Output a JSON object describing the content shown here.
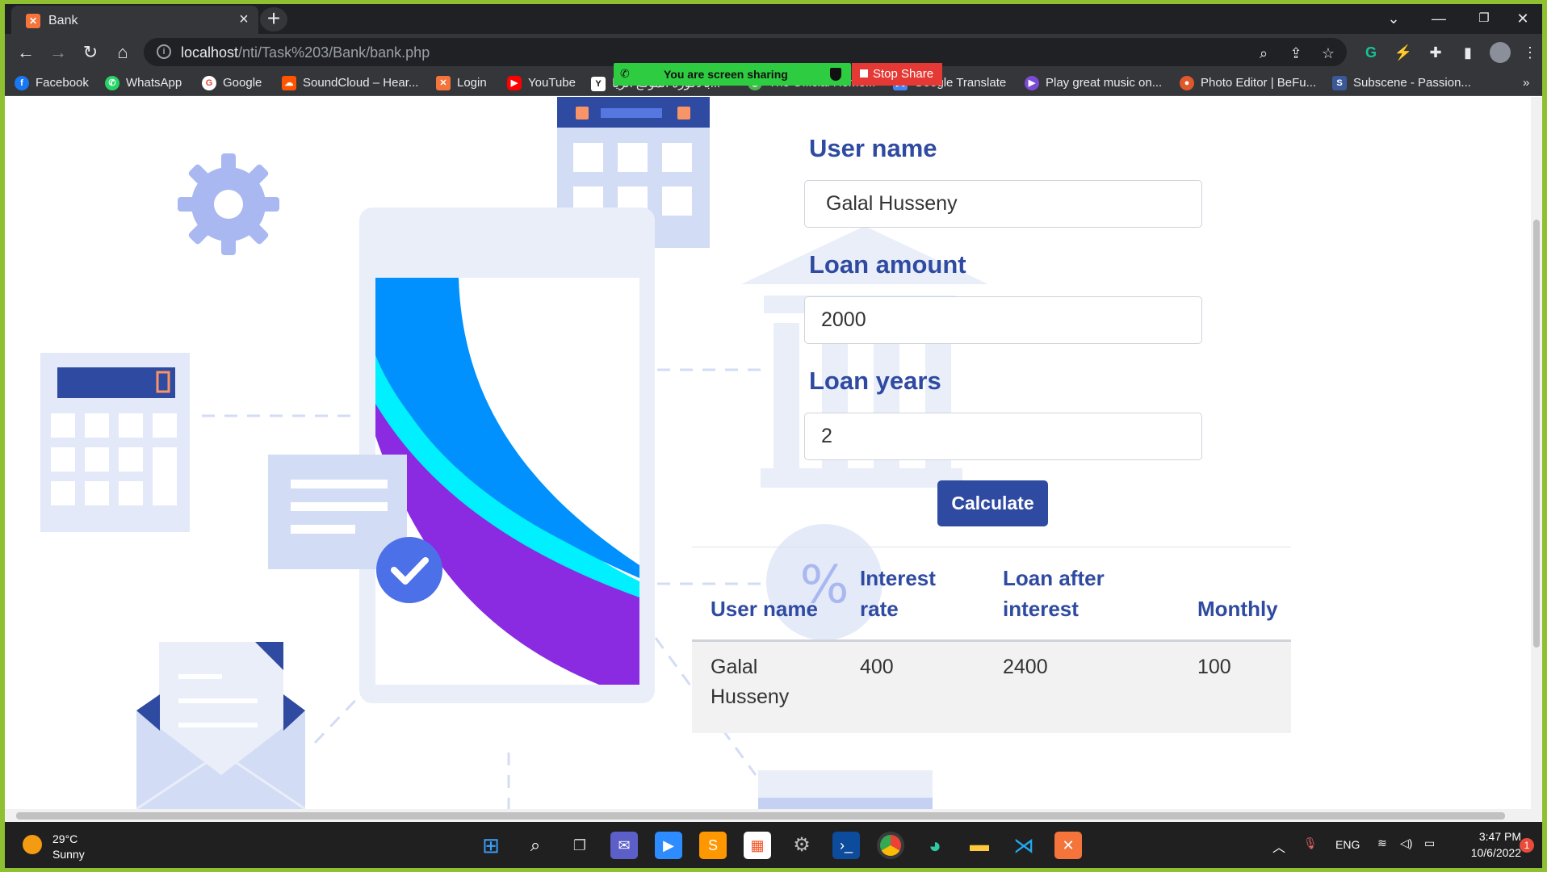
{
  "browser": {
    "tab_title": "Bank",
    "tab_favicon": "xampp-icon",
    "url_host": "localhost",
    "url_path": "/nti/Task%203/Bank/bank.php",
    "bookmarks": [
      {
        "label": "Facebook",
        "icon": "facebook-icon",
        "color": "#1877f2"
      },
      {
        "label": "WhatsApp",
        "icon": "whatsapp-icon",
        "color": "#25d366"
      },
      {
        "label": "Google",
        "icon": "google-icon",
        "color": "#ea4335"
      },
      {
        "label": "SoundCloud – Hear...",
        "icon": "soundcloud-icon",
        "color": "#ff5500"
      },
      {
        "label": "Login",
        "icon": "xampp-icon",
        "color": "#f4743b"
      },
      {
        "label": "YouTube",
        "icon": "youtube-icon",
        "color": "#ff0000"
      },
      {
        "label": "بالاكورة الموقع الريا...",
        "icon": "yallakora-icon",
        "color": "#111111"
      },
      {
        "label": "The Official Home...",
        "icon": "site-icon",
        "color": "#4caf50"
      },
      {
        "label": "Google Translate",
        "icon": "translate-icon",
        "color": "#4285f4"
      },
      {
        "label": "Play great music on...",
        "icon": "music-icon",
        "color": "#7b4bd6"
      },
      {
        "label": "Photo Editor | BeFu...",
        "icon": "befunky-icon",
        "color": "#e0582b"
      },
      {
        "label": "Subscene - Passion...",
        "icon": "subscene-icon",
        "color": "#3b5998"
      }
    ],
    "bookmarks_overflow": "»"
  },
  "screen_share": {
    "message": "You are screen sharing",
    "stop_label": "Stop Share"
  },
  "form": {
    "username_label": "User name",
    "username_value": "Galal Husseny",
    "amount_label": "Loan amount",
    "amount_value": "2000",
    "years_label": "Loan years",
    "years_value": "2",
    "submit_label": "Calculate"
  },
  "table": {
    "headers": [
      "User name",
      "Interest rate",
      "Loan after interest",
      "Monthly"
    ],
    "rows": [
      [
        "Galal Husseny",
        "400",
        "2400",
        "100"
      ]
    ]
  },
  "taskbar": {
    "weather_temp": "29°C",
    "weather_desc": "Sunny",
    "language": "ENG",
    "time": "3:47 PM",
    "date": "10/6/2022",
    "notification_count": "1"
  },
  "colors": {
    "primary": "#2f4aa1",
    "accent_blue": "#0091ff",
    "accent_cyan": "#00f0ff",
    "accent_purple": "#8a2be2",
    "illustration_light": "#dfe6f7"
  }
}
